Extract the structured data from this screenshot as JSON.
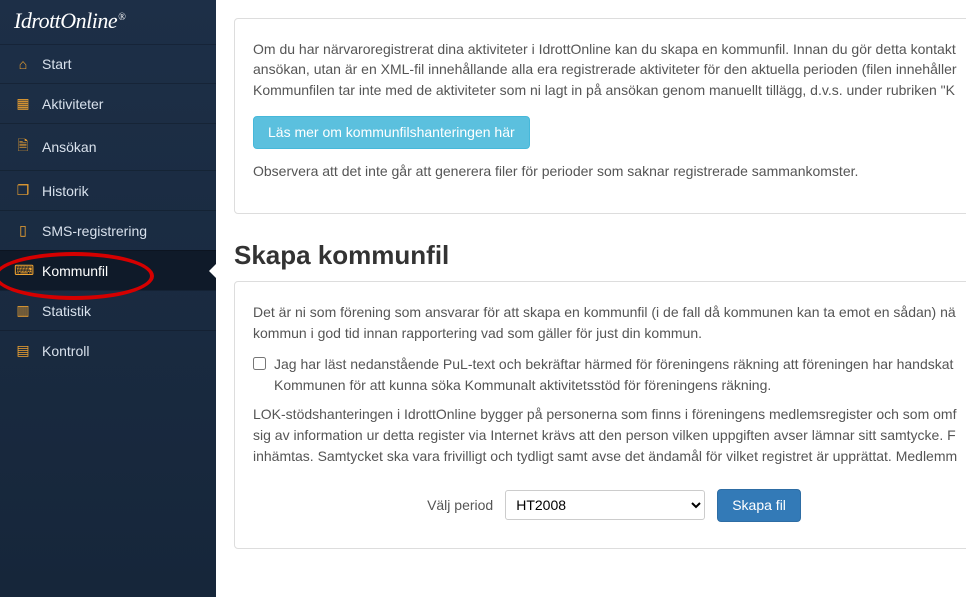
{
  "logo": "IdrottOnline",
  "nav": {
    "start": "Start",
    "aktiviteter": "Aktiviteter",
    "ansokan": "Ansökan",
    "historik": "Historik",
    "sms": "SMS-registrering",
    "kommunfil": "Kommunfil",
    "statistik": "Statistik",
    "kontroll": "Kontroll"
  },
  "intro": {
    "p1": "Om du har närvaroregistrerat dina aktiviteter i IdrottOnline kan du skapa en kommunfil. Innan du gör detta kontakt ansökan, utan är en XML-fil innehållande alla era registrerade aktiviteter för den aktuella perioden (filen innehåller Kommunfilen tar inte med de aktiviteter som ni lagt in på ansökan genom manuellt tillägg, d.v.s. under rubriken \"K",
    "more_btn": "Läs mer om kommunfilshanteringen här",
    "p2": "Observera att det inte går att generera filer för perioder som saknar registrerade sammankomster."
  },
  "section_title": "Skapa kommunfil",
  "create": {
    "p1": "Det är ni som förening som ansvarar för att skapa en kommunfil (i de fall då kommunen kan ta emot en sådan) nä kommun i god tid innan rapportering vad som gäller för just din kommun.",
    "cb_label": "Jag har läst nedanstående PuL-text och bekräftar härmed för föreningens räkning att föreningen har handskat Kommunen för att kunna söka Kommunalt aktivitetsstöd för föreningens räkning.",
    "p2": "LOK-stödshanteringen i IdrottOnline bygger på personerna som finns i föreningens medlemsregister och som omf sig av information ur detta register via Internet krävs att den person vilken uppgiften avser lämnar sitt samtycke. F inhämtas. Samtycket ska vara frivilligt och tydligt samt avse det ändamål för vilket registret är upprättat. Medlemm",
    "period_label": "Välj period",
    "period_value": "HT2008",
    "create_btn": "Skapa fil"
  }
}
